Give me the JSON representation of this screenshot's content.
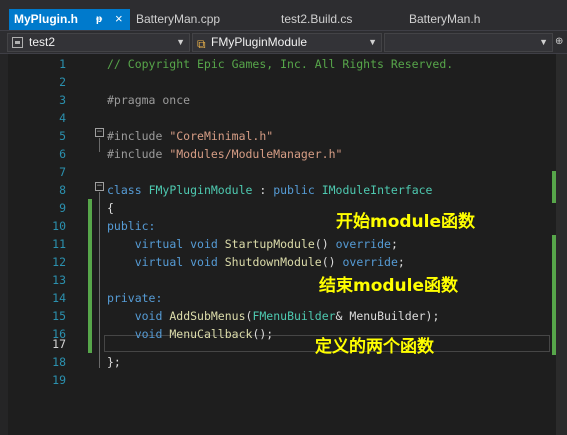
{
  "tabs": [
    {
      "label": "MyPlugin.h",
      "active": true
    },
    {
      "label": "BatteryMan.cpp",
      "active": false
    },
    {
      "label": "test2.Build.cs",
      "active": false
    },
    {
      "label": "BatteryMan.h",
      "active": false
    }
  ],
  "tab_controls": {
    "pin": "ᵽ",
    "close": "×"
  },
  "navbar": {
    "project": "test2",
    "scope": "FMyPluginModule",
    "member": ""
  },
  "line_numbers": [
    "1",
    "2",
    "3",
    "4",
    "5",
    "6",
    "7",
    "8",
    "9",
    "10",
    "11",
    "12",
    "13",
    "14",
    "15",
    "16",
    "17",
    "18",
    "19"
  ],
  "current_line": "17",
  "code": {
    "l1": "// Copyright Epic Games, Inc. All Rights Reserved.",
    "l3": "#pragma once",
    "l5_kw": "#include",
    "l5_str": "\"CoreMinimal.h\"",
    "l6_kw": "#include",
    "l6_str": "\"Modules/ModuleManager.h\"",
    "l8_class": "class",
    "l8_name": "FMyPluginModule",
    "l8_colon": " : ",
    "l8_public": "public",
    "l8_base": "IModuleInterface",
    "l9": "{",
    "l10": "public:",
    "l11_virtual": "virtual",
    "l11_void": "void",
    "l11_fn": "StartupModule",
    "l11_paren": "()",
    "l11_override": "override",
    "l11_end": ";",
    "l12_virtual": "virtual",
    "l12_void": "void",
    "l12_fn": "ShutdownModule",
    "l12_paren": "()",
    "l12_override": "override",
    "l12_end": ";",
    "l14": "private:",
    "l15_void": "void",
    "l15_fn": "AddSubMenus",
    "l15_open": "(",
    "l15_type": "FMenuBuilder",
    "l15_rest": "& MenuBuilder);",
    "l16_void": "void",
    "l16_fn": "MenuCallback",
    "l16_rest": "();",
    "l18": "};"
  },
  "annotations": {
    "a1": "开始module函数",
    "a2": "结束module函数",
    "a3": "定义的两个函数"
  },
  "colors": {
    "keyword": "#569cd6",
    "type": "#4ec9b0",
    "function": "#dcdcaa",
    "string": "#d69d85",
    "comment": "#57a64a",
    "annotation": "#ffff00",
    "active_tab": "#007acc"
  }
}
